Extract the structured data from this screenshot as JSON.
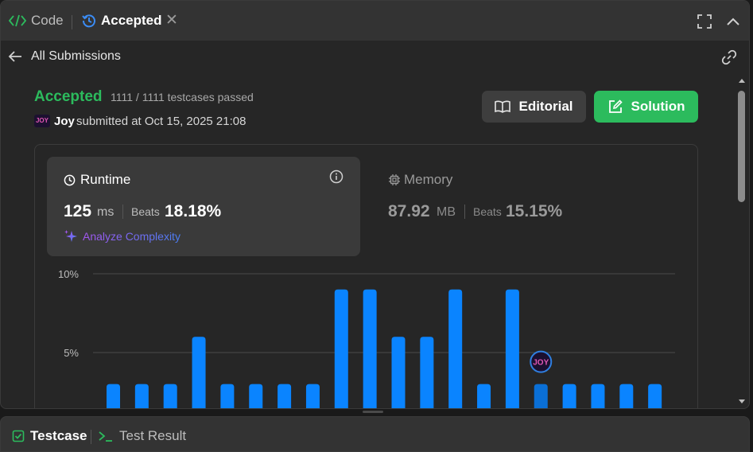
{
  "tabs": {
    "code_label": "Code",
    "accepted_label": "Accepted",
    "close_glyph": "✕"
  },
  "subheader": {
    "back_label": "All Submissions"
  },
  "submission": {
    "status": "Accepted",
    "testcases": "1111 / 1111 testcases passed",
    "avatar_text": "JOY",
    "user": "Joy",
    "submitted_at": "submitted at Oct 15, 2025 21:08"
  },
  "buttons": {
    "editorial": "Editorial",
    "solution": "Solution"
  },
  "runtime": {
    "title": "Runtime",
    "value": "125",
    "unit": "ms",
    "beats_label": "Beats",
    "beats_value": "18.18%",
    "analyze_label": "Analyze Complexity"
  },
  "memory": {
    "title": "Memory",
    "value": "87.92",
    "unit": "MB",
    "beats_label": "Beats",
    "beats_value": "15.15%"
  },
  "chart_data": {
    "type": "bar",
    "ytick_labels": [
      "10%",
      "5%"
    ],
    "ytick_values": [
      10,
      5
    ],
    "values": [
      3,
      3,
      3,
      6,
      3,
      3,
      3,
      3,
      9,
      9,
      6,
      6,
      9,
      3,
      9,
      3,
      3,
      3,
      3,
      3
    ],
    "highlight_index": 15,
    "marker_text": "JOY",
    "bar_color": "#0a84ff",
    "highlight_color": "#0a6fd6"
  },
  "bottom": {
    "testcase_label": "Testcase",
    "result_label": "Test Result"
  },
  "colors": {
    "accent_green": "#2cbb5d",
    "bar_blue": "#0a84ff"
  }
}
